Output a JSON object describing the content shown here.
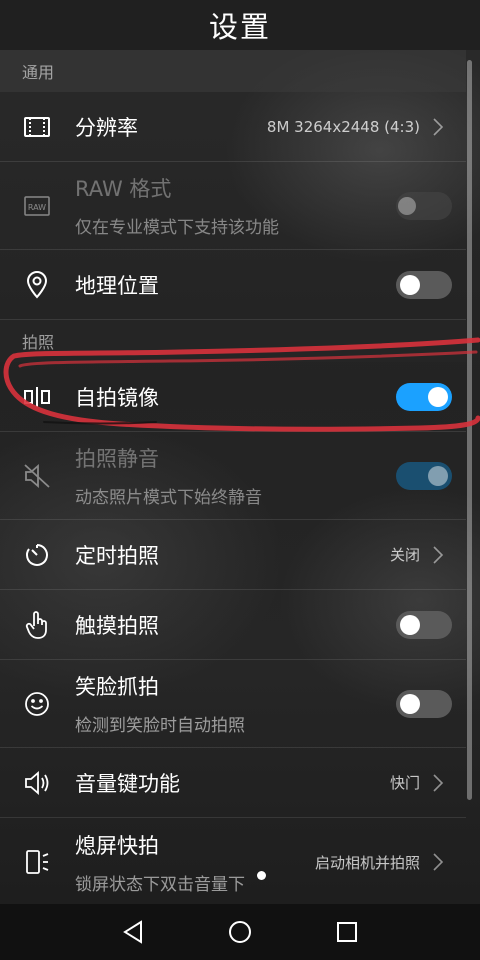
{
  "header": {
    "title": "设置"
  },
  "sections": {
    "general": "通用",
    "photo": "拍照"
  },
  "rows": {
    "resolution": {
      "title": "分辨率",
      "value": "8M 3264x2448 (4:3)",
      "icon": "resolution-icon"
    },
    "raw": {
      "title": "RAW 格式",
      "subtitle": "仅在专业模式下支持该功能",
      "icon": "raw-icon",
      "toggle": "off",
      "enabled": false
    },
    "location": {
      "title": "地理位置",
      "icon": "location-pin-icon",
      "toggle": "off"
    },
    "mirror": {
      "title": "自拍镜像",
      "icon": "mirror-icon",
      "toggle": "on"
    },
    "mute": {
      "title": "拍照静音",
      "subtitle": "动态照片模式下始终静音",
      "icon": "mute-icon",
      "toggle": "on",
      "enabled": false
    },
    "timer": {
      "title": "定时拍照",
      "value": "关闭",
      "icon": "timer-icon"
    },
    "touch": {
      "title": "触摸拍照",
      "icon": "touch-icon",
      "toggle": "off"
    },
    "smile": {
      "title": "笑脸抓拍",
      "subtitle": "检测到笑脸时自动拍照",
      "icon": "smile-icon",
      "toggle": "off"
    },
    "volume": {
      "title": "音量键功能",
      "value": "快门",
      "icon": "volume-icon"
    },
    "ultra": {
      "title": "熄屏快拍",
      "subtitle": "锁屏状态下双击音量下",
      "value": "启动相机并拍照",
      "icon": "phone-flash-icon"
    }
  },
  "colors": {
    "accent": "#1ba1ff",
    "annotation": "#d8323c"
  },
  "navigation": {
    "back": "back-triangle-icon",
    "home": "home-circle-icon",
    "recents": "recents-square-icon"
  }
}
